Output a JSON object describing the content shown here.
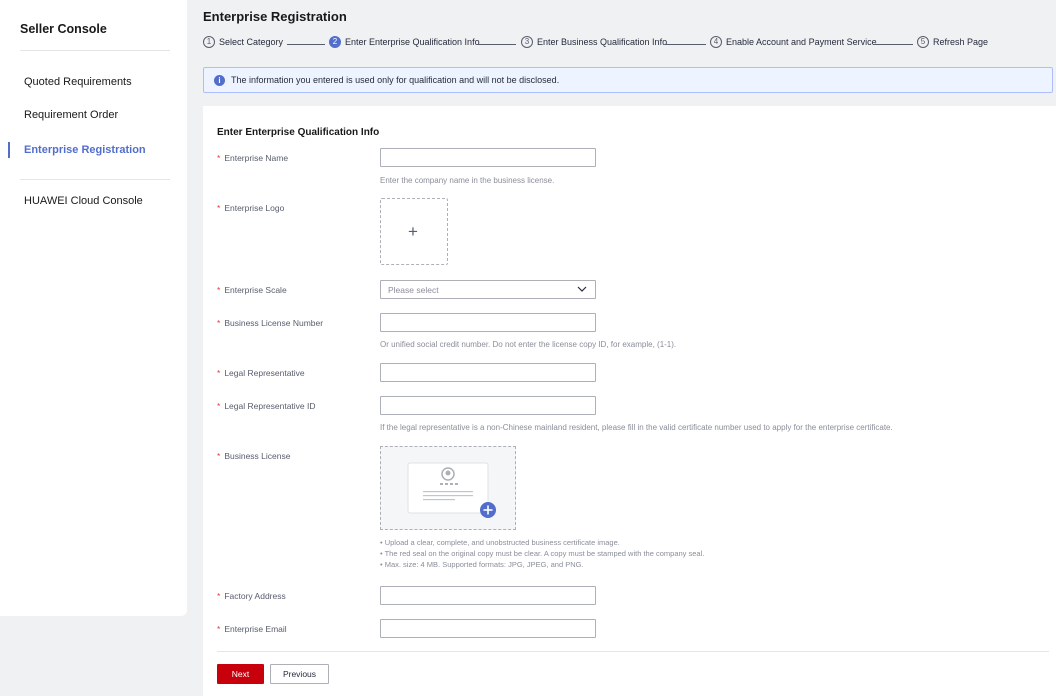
{
  "sidebar": {
    "title": "Seller Console",
    "items": [
      {
        "label": "Quoted Requirements"
      },
      {
        "label": "Requirement Order"
      },
      {
        "label": "Enterprise Registration"
      },
      {
        "label": "HUAWEI Cloud Console"
      }
    ],
    "active_index": 2
  },
  "header": {
    "title": "Enterprise Registration",
    "steps": [
      {
        "num": "1",
        "label": "Select Category"
      },
      {
        "num": "2",
        "label": "Enter Enterprise Qualification Info"
      },
      {
        "num": "3",
        "label": "Enter Business Qualification Info"
      },
      {
        "num": "4",
        "label": "Enable Account and Payment Service"
      },
      {
        "num": "5",
        "label": "Refresh Page"
      }
    ],
    "current_step": 2
  },
  "info": {
    "icon": "info-icon",
    "text": "The information you entered is used only for qualification and will not be disclosed."
  },
  "form": {
    "section_title": "Enter Enterprise Qualification Info",
    "required_mark": "*",
    "fields": {
      "enterprise_name": {
        "label": "Enterprise Name",
        "value": "",
        "help": "Enter the company name in the business license."
      },
      "enterprise_logo": {
        "label": "Enterprise Logo",
        "upload_glyph": "+"
      },
      "enterprise_scale": {
        "label": "Enterprise Scale",
        "placeholder": "Please select"
      },
      "license_number": {
        "label": "Business License Number",
        "value": "",
        "help": "Or unified social credit number. Do not enter the license copy ID, for example, (1-1)."
      },
      "legal_rep": {
        "label": "Legal Representative",
        "value": ""
      },
      "legal_rep_id": {
        "label": "Legal Representative ID",
        "value": "",
        "help": "If the legal representative is a non-Chinese mainland resident, please fill in the valid certificate number used to apply for the enterprise certificate."
      },
      "business_license": {
        "label": "Business License",
        "notes": [
          "• Upload a clear, complete, and unobstructed business certificate image.",
          "• The red seal on the original copy must be clear. A copy must be stamped with the company seal.",
          "• Max. size: 4 MB. Supported formats: JPG, JPEG, and PNG."
        ]
      },
      "factory_address": {
        "label": "Factory Address",
        "value": ""
      },
      "enterprise_email": {
        "label": "Enterprise Email",
        "value": ""
      }
    },
    "buttons": {
      "next": "Next",
      "previous": "Previous"
    }
  },
  "colors": {
    "accent": "#526ecc",
    "primary_button": "#c7000b",
    "required": "#e4393c"
  }
}
